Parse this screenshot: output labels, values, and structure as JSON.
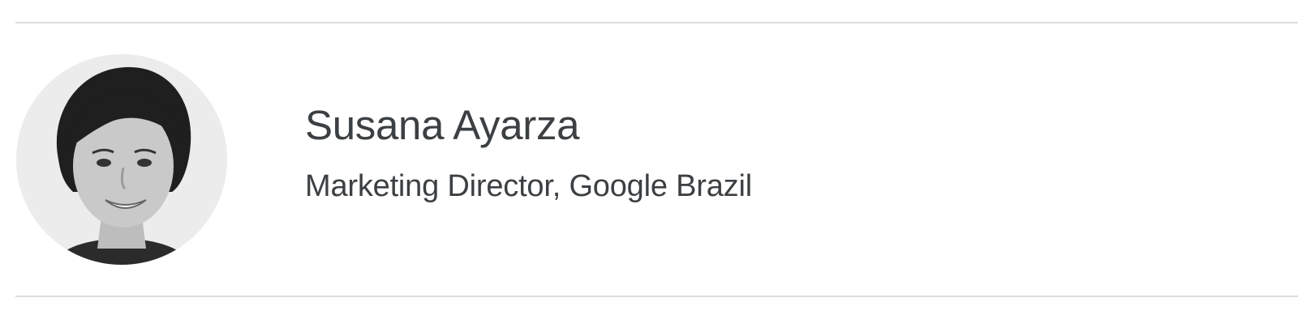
{
  "profile": {
    "name": "Susana Ayarza",
    "title": "Marketing Director, Google Brazil",
    "avatar_icon": "person-photo-icon"
  },
  "colors": {
    "text": "#3c4043",
    "divider": "#dadce0",
    "avatar_background": "#ececec"
  }
}
